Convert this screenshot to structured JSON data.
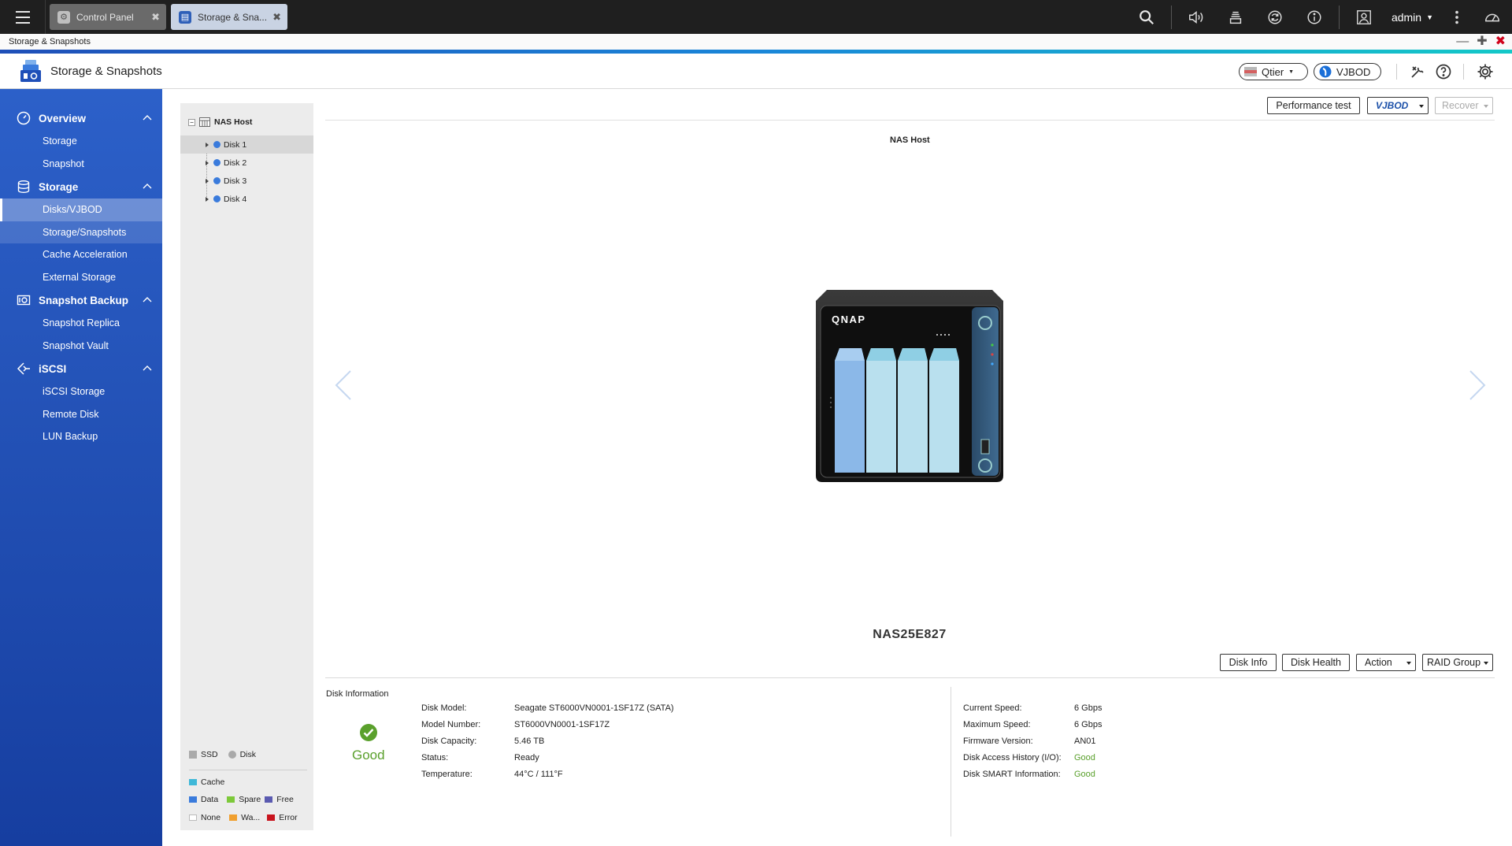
{
  "topbar": {
    "tabs": [
      {
        "label": "Control Panel"
      },
      {
        "label": "Storage & Sna..."
      }
    ],
    "user": "admin"
  },
  "window": {
    "title": "Storage & Snapshots"
  },
  "app": {
    "title": "Storage & Snapshots",
    "qtier_label": "Qtier",
    "vjbod_label": "VJBOD"
  },
  "sidebar": {
    "sections": [
      {
        "label": "Overview",
        "items": [
          "Storage",
          "Snapshot"
        ]
      },
      {
        "label": "Storage",
        "items": [
          "Disks/VJBOD",
          "Storage/Snapshots",
          "Cache Acceleration",
          "External Storage"
        ]
      },
      {
        "label": "Snapshot Backup",
        "items": [
          "Snapshot Replica",
          "Snapshot Vault"
        ]
      },
      {
        "label": "iSCSI",
        "items": [
          "iSCSI Storage",
          "Remote Disk",
          "LUN Backup"
        ]
      }
    ],
    "active_item": "Disks/VJBOD"
  },
  "tree": {
    "root": "NAS Host",
    "disks": [
      "Disk 1",
      "Disk 2",
      "Disk 3",
      "Disk 4"
    ],
    "selected": "Disk 1"
  },
  "legend": {
    "ssd": "SSD",
    "disk": "Disk",
    "cache": "Cache",
    "data": "Data",
    "spare": "Spare",
    "free": "Free",
    "none": "None",
    "warning": "Wa...",
    "error": "Error",
    "colors": {
      "cache": "#3fb8d8",
      "data": "#3a7bdc",
      "spare": "#7dc93a",
      "free": "#5a5ab0",
      "none": "#ffffff",
      "warning": "#f0a030",
      "error": "#c8141e"
    }
  },
  "toolbar": {
    "performance_test": "Performance test",
    "vjbod": "VJBOD",
    "recover": "Recover"
  },
  "device": {
    "label": "NAS Host",
    "brand": "QNAP",
    "name": "NAS25E827"
  },
  "actions": {
    "disk_info": "Disk Info",
    "disk_health": "Disk Health",
    "action": "Action",
    "raid_group": "RAID Group"
  },
  "disk_info": {
    "title": "Disk Information",
    "status_text": "Good",
    "left": [
      {
        "key": "Disk Model:",
        "value": "Seagate ST6000VN0001-1SF17Z (SATA)"
      },
      {
        "key": "Model Number:",
        "value": "ST6000VN0001-1SF17Z"
      },
      {
        "key": "Disk Capacity:",
        "value": "5.46 TB"
      },
      {
        "key": "Status:",
        "value": "Ready"
      },
      {
        "key": "Temperature:",
        "value": "44°C / 111°F"
      }
    ],
    "right": [
      {
        "key": "Current Speed:",
        "value": "6 Gbps"
      },
      {
        "key": "Maximum Speed:",
        "value": "6 Gbps"
      },
      {
        "key": "Firmware Version:",
        "value": "AN01"
      },
      {
        "key": "Disk Access History (I/O):",
        "value": "Good"
      },
      {
        "key": "Disk SMART Information:",
        "value": "Good"
      }
    ],
    "good_color": "#5aa02c"
  }
}
